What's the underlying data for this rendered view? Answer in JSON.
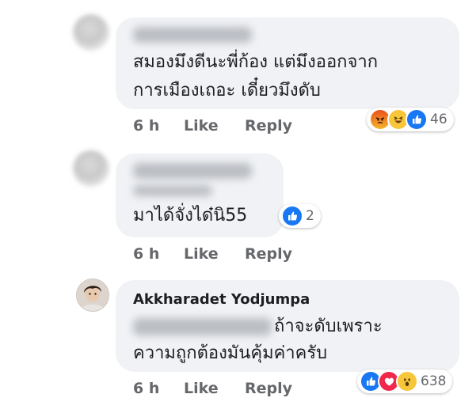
{
  "comments": [
    {
      "text_lines": [
        "สมองมึงดีนะพี่ก้อง แต่มึงออกจาก",
        "การเมืองเถอะ เดี๋ยวมึงดับ"
      ],
      "time": "6 h",
      "like_label": "Like",
      "reply_label": "Reply",
      "reactions": [
        "angry-icon",
        "haha-icon",
        "like-icon"
      ],
      "reaction_count": "46"
    },
    {
      "text_lines": [
        "มาได้จั่งได๋นิ55"
      ],
      "time": "6 h",
      "like_label": "Like",
      "reply_label": "Reply",
      "reactions": [
        "like-icon"
      ],
      "reaction_count": "2"
    },
    {
      "author": "Akkharadet Yodjumpa",
      "text_lines": [
        "ถ้าจะดับเพราะ",
        "ความถูกต้องมันคุ้มค่าครับ"
      ],
      "time": "6 h",
      "like_label": "Like",
      "reply_label": "Reply",
      "reactions": [
        "like-icon",
        "love-icon",
        "wow-icon"
      ],
      "reaction_count": "638"
    }
  ],
  "colors": {
    "bubble": "#f0f2f5",
    "muted_text": "#65676b",
    "like_blue": "#1877f2",
    "love_red": "#f0284a"
  }
}
